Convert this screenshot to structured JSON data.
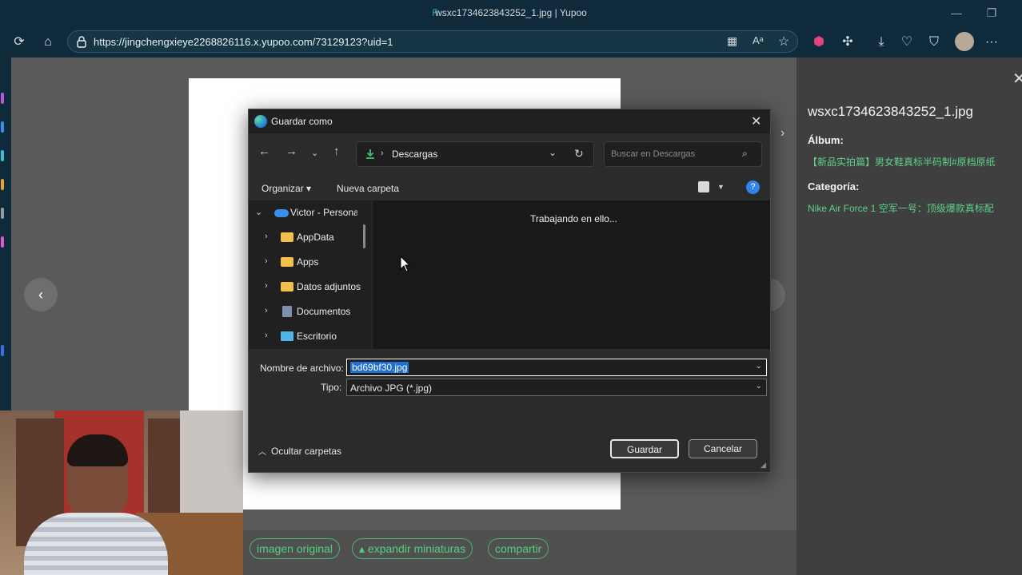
{
  "browser": {
    "window_title": "wsxc1734623843252_1.jpg | Yupoo",
    "url": "https://jingchengxieye2268826116.x.yupoo.com/73129123?uid=1"
  },
  "photo_panel": {
    "filename": "wsxc1734623843252_1.jpg",
    "album_label": "Álbum:",
    "album_value": "【新品实拍篇】男女鞋真标半码制#原档原纸",
    "category_label": "Categoría:",
    "category_value": "Nike Air Force 1 空军一号：顶级爆款真标配"
  },
  "bottom_actions": {
    "original": "imagen original",
    "expand": "▴ expandir miniaturas",
    "share": "compartir"
  },
  "dialog": {
    "title": "Guardar como",
    "path": "Descargas",
    "search_placeholder": "Buscar en Descargas",
    "organize": "Organizar ▾",
    "new_folder": "Nueva carpeta",
    "working": "Trabajando en ello...",
    "tree": [
      {
        "label": "Victor - Persona",
        "expanded": true
      },
      {
        "label": "AppData"
      },
      {
        "label": "Apps"
      },
      {
        "label": "Datos adjuntos"
      },
      {
        "label": "Documentos"
      },
      {
        "label": "Escritorio"
      }
    ],
    "filename_label": "Nombre de archivo:",
    "filename_value": "bd69bf30.jpg",
    "type_label": "Tipo:",
    "type_value": "Archivo JPG (*.jpg)",
    "hide_folders": "Ocultar carpetas",
    "save": "Guardar",
    "cancel": "Cancelar"
  }
}
